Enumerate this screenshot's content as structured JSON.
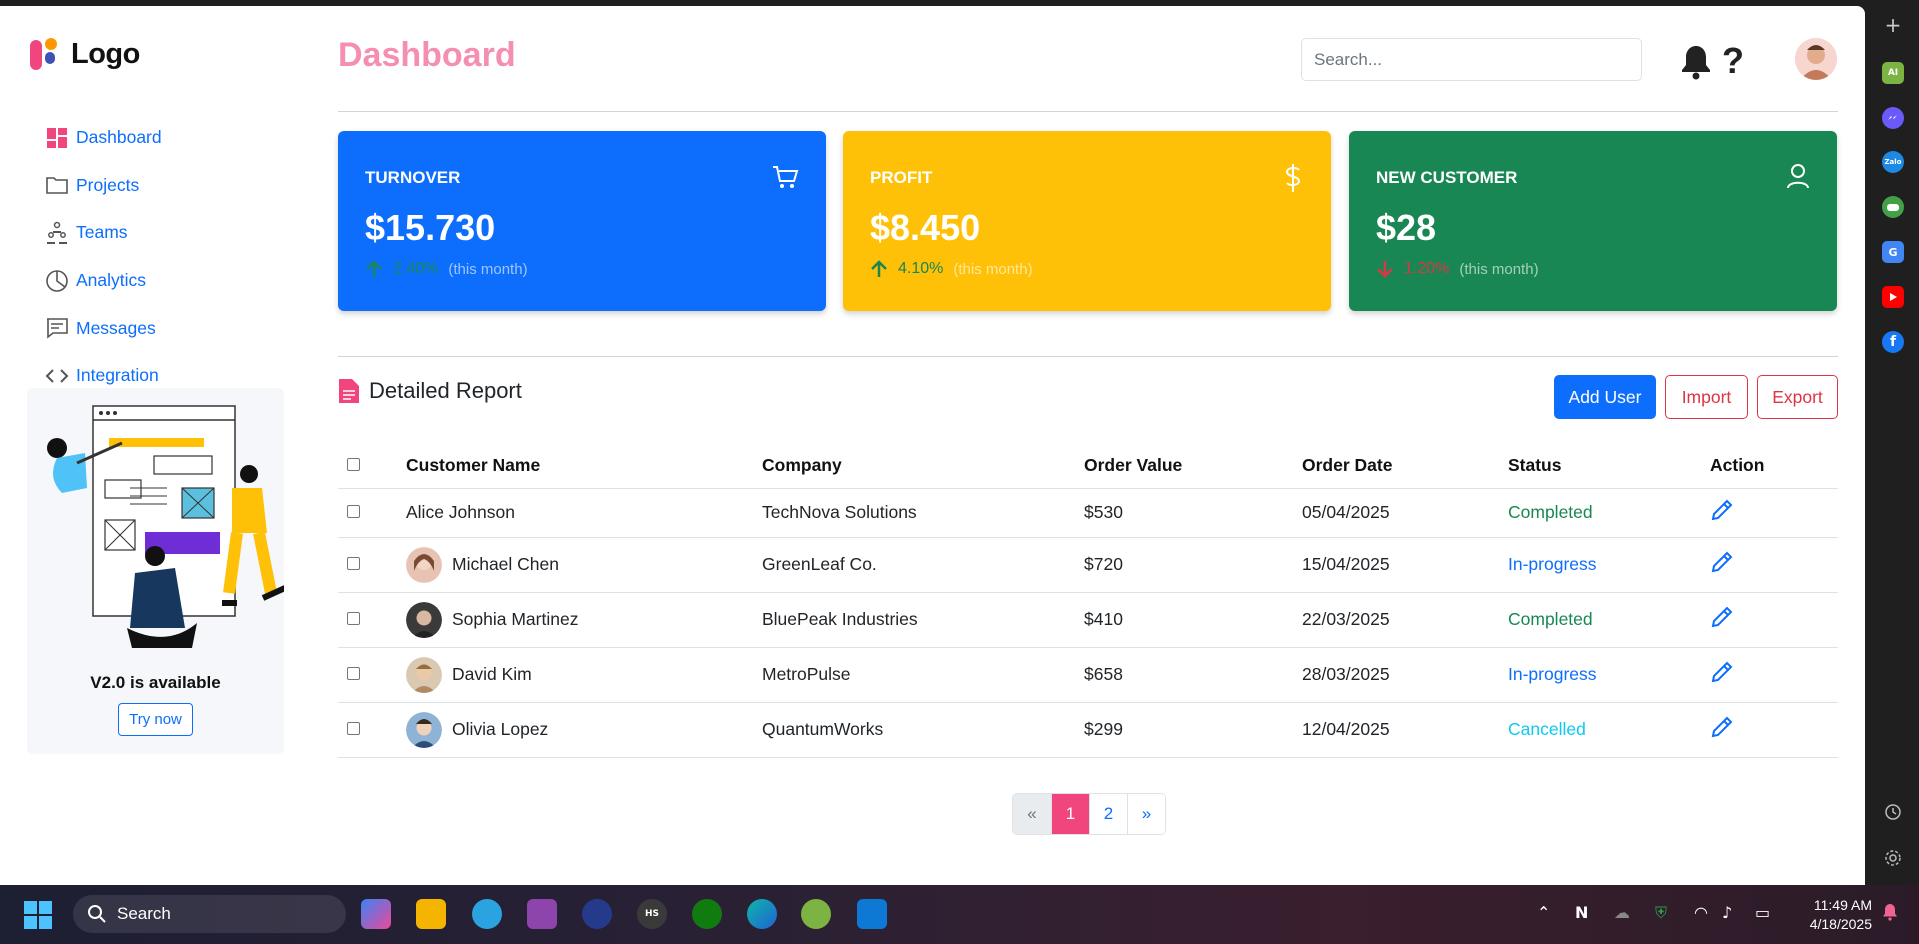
{
  "app": {
    "logo_text": "Logo",
    "page_title": "Dashboard",
    "accent_color": "#0d6efd",
    "title_color": "#f48fb1"
  },
  "sidebar": {
    "items": [
      {
        "label": "Dashboard",
        "icon": "dashboard-icon"
      },
      {
        "label": "Projects",
        "icon": "folder-icon"
      },
      {
        "label": "Teams",
        "icon": "teams-icon"
      },
      {
        "label": "Analytics",
        "icon": "pie-chart-icon"
      },
      {
        "label": "Messages",
        "icon": "message-icon"
      },
      {
        "label": "Integration",
        "icon": "code-icon"
      }
    ],
    "promo": {
      "title": "V2.0 is available",
      "button": "Try now"
    }
  },
  "header": {
    "search_placeholder": "Search...",
    "help_glyph": "?"
  },
  "stats": [
    {
      "label": "TURNOVER",
      "value": "$15.730",
      "change": "2.40%",
      "period": "(this month)",
      "direction": "up",
      "icon": "cart-icon",
      "color": "#0d6efd"
    },
    {
      "label": "PROFIT",
      "value": "$8.450",
      "change": "4.10%",
      "period": "(this month)",
      "direction": "up",
      "icon": "dollar-icon",
      "color": "#ffc107"
    },
    {
      "label": "NEW CUSTOMER",
      "value": "$28",
      "change": "1.20%",
      "period": "(this month)",
      "direction": "down",
      "icon": "user-icon",
      "color": "#198754"
    }
  ],
  "report": {
    "title": "Detailed Report",
    "buttons": {
      "add": "Add User",
      "import": "Import",
      "export": "Export"
    },
    "columns": [
      "Customer Name",
      "Company",
      "Order Value",
      "Order Date",
      "Status",
      "Action"
    ],
    "rows": [
      {
        "name": "Alice Johnson",
        "company": "TechNova Solutions",
        "value": "$530",
        "date": "05/04/2025",
        "status": "Completed"
      },
      {
        "name": "Michael Chen",
        "company": "GreenLeaf Co.",
        "value": "$720",
        "date": "15/04/2025",
        "status": "In-progress"
      },
      {
        "name": "Sophia Martinez",
        "company": "BluePeak Industries",
        "value": "$410",
        "date": "22/03/2025",
        "status": "Completed"
      },
      {
        "name": "David Kim",
        "company": "MetroPulse",
        "value": "$658",
        "date": "28/03/2025",
        "status": "In-progress"
      },
      {
        "name": "Olivia Lopez",
        "company": "QuantumWorks",
        "value": "$299",
        "date": "12/04/2025",
        "status": "Cancelled"
      }
    ]
  },
  "pagination": {
    "prev": "«",
    "pages": [
      "1",
      "2"
    ],
    "next": "»",
    "current": "1"
  },
  "taskbar": {
    "search_label": "Search",
    "time": "11:49 AM",
    "date": "4/18/2025"
  }
}
